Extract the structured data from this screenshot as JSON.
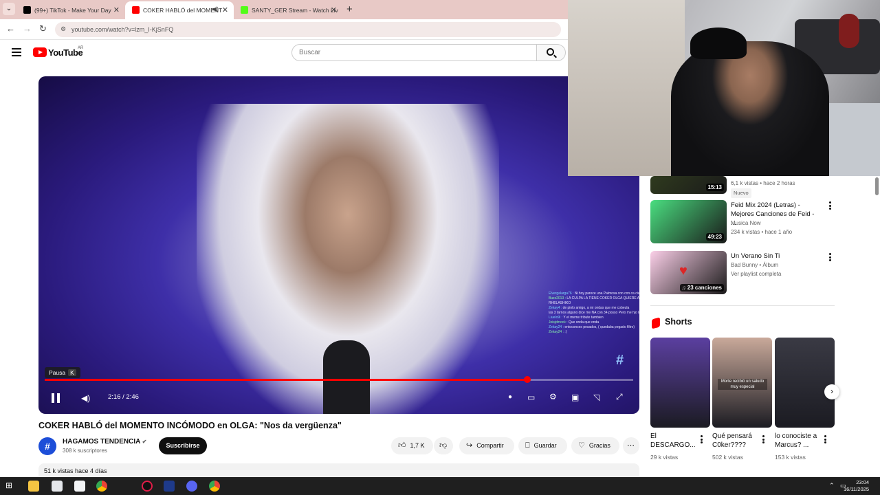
{
  "browser": {
    "tabs": [
      {
        "title": "(99+) TikTok - Make Your Day",
        "favicon_color": "#000000"
      },
      {
        "title": "COKER HABLÓ del MOMENT",
        "favicon_color": "#ff0000"
      },
      {
        "title": "SANTY_GER Stream - Watch Liv",
        "favicon_color": "#53fc18"
      }
    ],
    "url": "youtube.com/watch?v=lzm_I-KjSnFQ"
  },
  "youtube": {
    "logo_text": "YouTube",
    "country_code": "AR",
    "search_placeholder": "Buscar"
  },
  "player": {
    "tooltip_label": "Pausa",
    "tooltip_key": "K",
    "current_time": "2:16",
    "duration": "2:46",
    "time_display": "2:16 / 2:46",
    "progress_fraction": 0.82,
    "chat_lines": [
      {
        "user": "Elvergalarga76 :",
        "text": "Ni hoy parece una Palmosa con con ca ciuda"
      },
      {
        "user": "Buzz2013 :",
        "text": "LA CULPA LA TIENE COKER OLGA QUIERE AGRADAR EN ES RHELASHIKO"
      },
      {
        "user": "Zekay4 :",
        "text": "de pinlo amigo, a mi ondas que me cobeula"
      },
      {
        "user": "",
        "text": "las 3 tarnos alguno dice me NA con 34 posso Pero me hjo la diferencia"
      },
      {
        "user": "Liuelo9l :",
        "text": "Y el meme tribute tambien"
      },
      {
        "user": "Jeisjdmock :",
        "text": "Que onda que onda"
      },
      {
        "user": "Zekay24 :",
        "text": "entoconces pesados, ( quedaba pegado filtro)"
      },
      {
        "user": "Zekay24 :",
        "text": ":)"
      }
    ]
  },
  "video": {
    "title": "COKER HABLÓ del MOMENTO INCÓMODO en OLGA: \"Nos da vergüenza\"",
    "channel": "HAGAMOS TENDENCIA",
    "subscribers": "308 k suscriptores",
    "subscribe_label": "Suscribirse",
    "likes": "1,7 K",
    "share_label": "Compartir",
    "save_label": "Guardar",
    "thanks_label": "Gracias",
    "views_date": "51 k vistas  hace 4 días"
  },
  "sidebar": {
    "recommended": [
      {
        "duration": "15:13",
        "title": "",
        "channel": "",
        "meta": "6,1 k vistas • hace 2 horas",
        "badge": "Nuevo",
        "thumb_color": "#2f3a1e"
      },
      {
        "duration": "49:23",
        "title": "Feid Mix 2024 (Letras) - Mejores Canciones de Feid - ...",
        "channel": "Musica Now",
        "meta": "234 k vistas • hace 1 año",
        "thumb_color": "#4ade80"
      },
      {
        "duration": "23 canciones",
        "title": "Un Verano Sin Ti",
        "channel": "Bad Bunny • Álbum",
        "meta": "Ver playlist completa",
        "thumb_color": "#fbcfe8"
      }
    ],
    "shorts_heading": "Shorts",
    "shorts": [
      {
        "title": "El DESCARGO...",
        "views": "29 k vistas",
        "overlay": "",
        "thumb_color": "#5b3fa0"
      },
      {
        "title": "Qué pensará C0ker????",
        "views": "502 k vistas",
        "overlay": "Morte recibió un saludo muy especial",
        "thumb_color": "#c9a99a"
      },
      {
        "title": "lo conociste a Marcus? ...",
        "views": "153 k vistas",
        "overlay": "",
        "thumb_color": "#3a3a44"
      }
    ]
  },
  "taskbar": {
    "time": "23:04",
    "date": "16/11/2025"
  }
}
